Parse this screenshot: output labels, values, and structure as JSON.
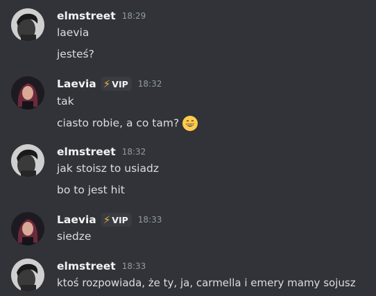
{
  "messages": [
    {
      "user": "elmstreet",
      "vip": false,
      "time": "18:29",
      "lines": [
        "laevia",
        "jesteś?"
      ]
    },
    {
      "user": "Laevia",
      "vip": true,
      "vip_label": "VIP",
      "time": "18:32",
      "lines": [
        "tak",
        "ciasto robie, a co tam?"
      ],
      "emoji": "grinning-face-emoji"
    },
    {
      "user": "elmstreet",
      "vip": false,
      "time": "18:32",
      "lines": [
        "jak stoisz to usiadz",
        "bo to jest hit"
      ]
    },
    {
      "user": "Laevia",
      "vip": true,
      "vip_label": "VIP",
      "time": "18:33",
      "lines": [
        "siedze"
      ]
    },
    {
      "user": "elmstreet",
      "vip": false,
      "time": "18:33",
      "lines": [
        "ktoś rozpowiada, że ty, ja, carmella i emery mamy sojusz"
      ]
    }
  ],
  "colors": {
    "background": "#313338",
    "username": "#f2f3f5",
    "text": "#dbdee1",
    "timestamp": "#949ba4",
    "vip_bolt": "#f0b232"
  }
}
